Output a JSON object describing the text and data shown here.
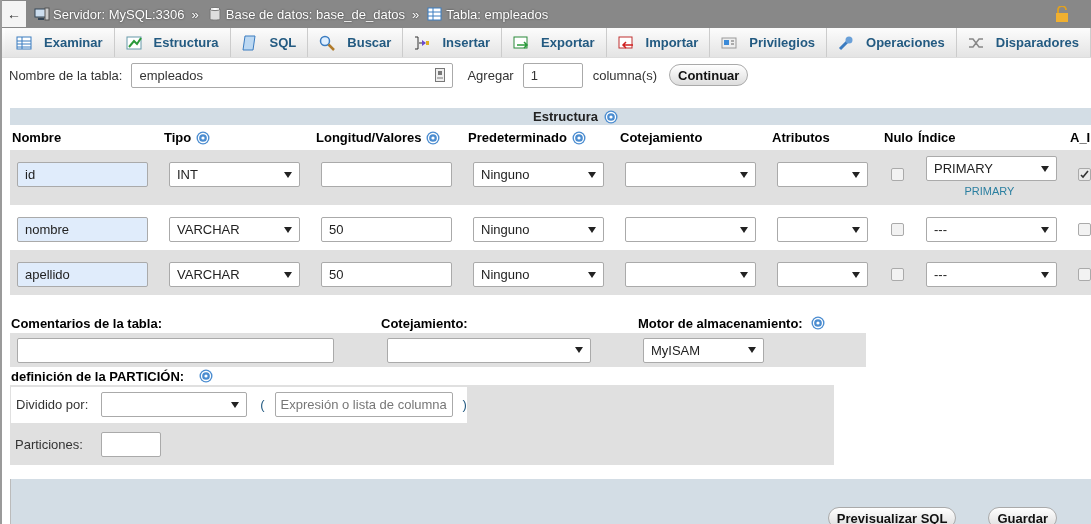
{
  "back_button": "←",
  "breadcrumb": [
    {
      "kind": "server",
      "label": "Servidor: MySQL:3306",
      "separator": "»"
    },
    {
      "kind": "database",
      "label": "Base de datos: base_de_datos",
      "separator": "»"
    },
    {
      "kind": "table",
      "label": "Tabla: empleados"
    }
  ],
  "tabs": [
    {
      "kind": "browse",
      "label": "Examinar"
    },
    {
      "kind": "structure",
      "label": "Estructura"
    },
    {
      "kind": "sql",
      "label": "SQL"
    },
    {
      "kind": "search",
      "label": "Buscar"
    },
    {
      "kind": "insert",
      "label": "Insertar"
    },
    {
      "kind": "export",
      "label": "Exportar"
    },
    {
      "kind": "import",
      "label": "Importar"
    },
    {
      "kind": "privileges",
      "label": "Privilegios"
    },
    {
      "kind": "operations",
      "label": "Operaciones"
    },
    {
      "kind": "triggers",
      "label": "Disparadores"
    }
  ],
  "table_name": {
    "label": "Nombre de la tabla:",
    "value": "empleados"
  },
  "add_columns": {
    "label": "Agregar",
    "value": "1",
    "unit": "columna(s)",
    "button": "Continuar"
  },
  "structure": {
    "title": "Estructura",
    "help": true,
    "columns": [
      {
        "label": "Nombre",
        "help": false
      },
      {
        "label": "Tipo",
        "help": true
      },
      {
        "label": "Longitud/Valores",
        "help": true
      },
      {
        "label": "Predeterminado",
        "help": true
      },
      {
        "label": "Cotejamiento",
        "help": false
      },
      {
        "label": "Atributos",
        "help": false
      },
      {
        "label": "Nulo",
        "help": false
      },
      {
        "label": "Índice",
        "help": false
      },
      {
        "label": "A_I",
        "help": false
      }
    ],
    "rows": [
      {
        "name": "id",
        "type": "INT",
        "length": "",
        "default": "Ninguno",
        "null": false,
        "index": "PRIMARY",
        "index_note": "PRIMARY",
        "auto_increment": true
      },
      {
        "name": "nombre",
        "type": "VARCHAR",
        "length": "50",
        "default": "Ninguno",
        "null": false,
        "index": "---",
        "auto_increment": false
      },
      {
        "name": "apellido",
        "type": "VARCHAR",
        "length": "50",
        "default": "Ninguno",
        "null": false,
        "index": "---",
        "auto_increment": false
      }
    ]
  },
  "table_options": {
    "comments_label": "Comentarios de la tabla:",
    "collation_label": "Cotejamiento:",
    "engine_label": "Motor de almacenamiento:",
    "engine_help": true,
    "engine": "MyISAM"
  },
  "partition": {
    "title": "definición de la PARTICIÓN:",
    "help": true,
    "divided_by_label": "Dividido por:",
    "open_paren": "(",
    "expression_placeholder": "Expresión o lista de columna",
    "close_paren": ")",
    "partitions_label": "Particiones:"
  },
  "footer_buttons": [
    "Previsualizar SQL",
    "Guardar"
  ]
}
